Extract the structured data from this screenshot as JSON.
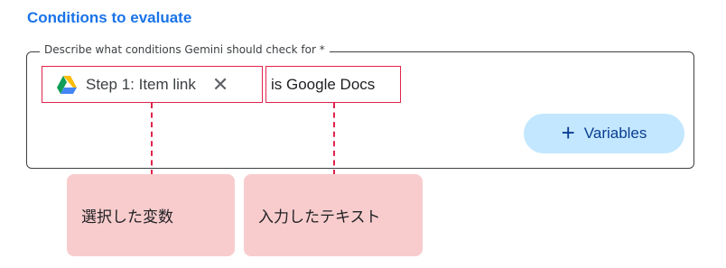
{
  "section": {
    "title": "Conditions to evaluate"
  },
  "field": {
    "legend": "Describe what conditions Gemini should check for *"
  },
  "chip": {
    "icon": "google-drive-icon",
    "label": "Step 1: Item link",
    "close_glyph": "✕"
  },
  "typed_text": "is Google Docs",
  "variables_button": {
    "icon": "plus-icon",
    "label": "Variables"
  },
  "annotations": {
    "variable": "選択した変数",
    "text": "入力したテキスト"
  },
  "colors": {
    "title": "#1a73e8",
    "highlight": "#e0234b",
    "annotation_bg": "#f8cccd",
    "button_bg": "#c2e7ff",
    "button_text": "#0b3d91"
  }
}
